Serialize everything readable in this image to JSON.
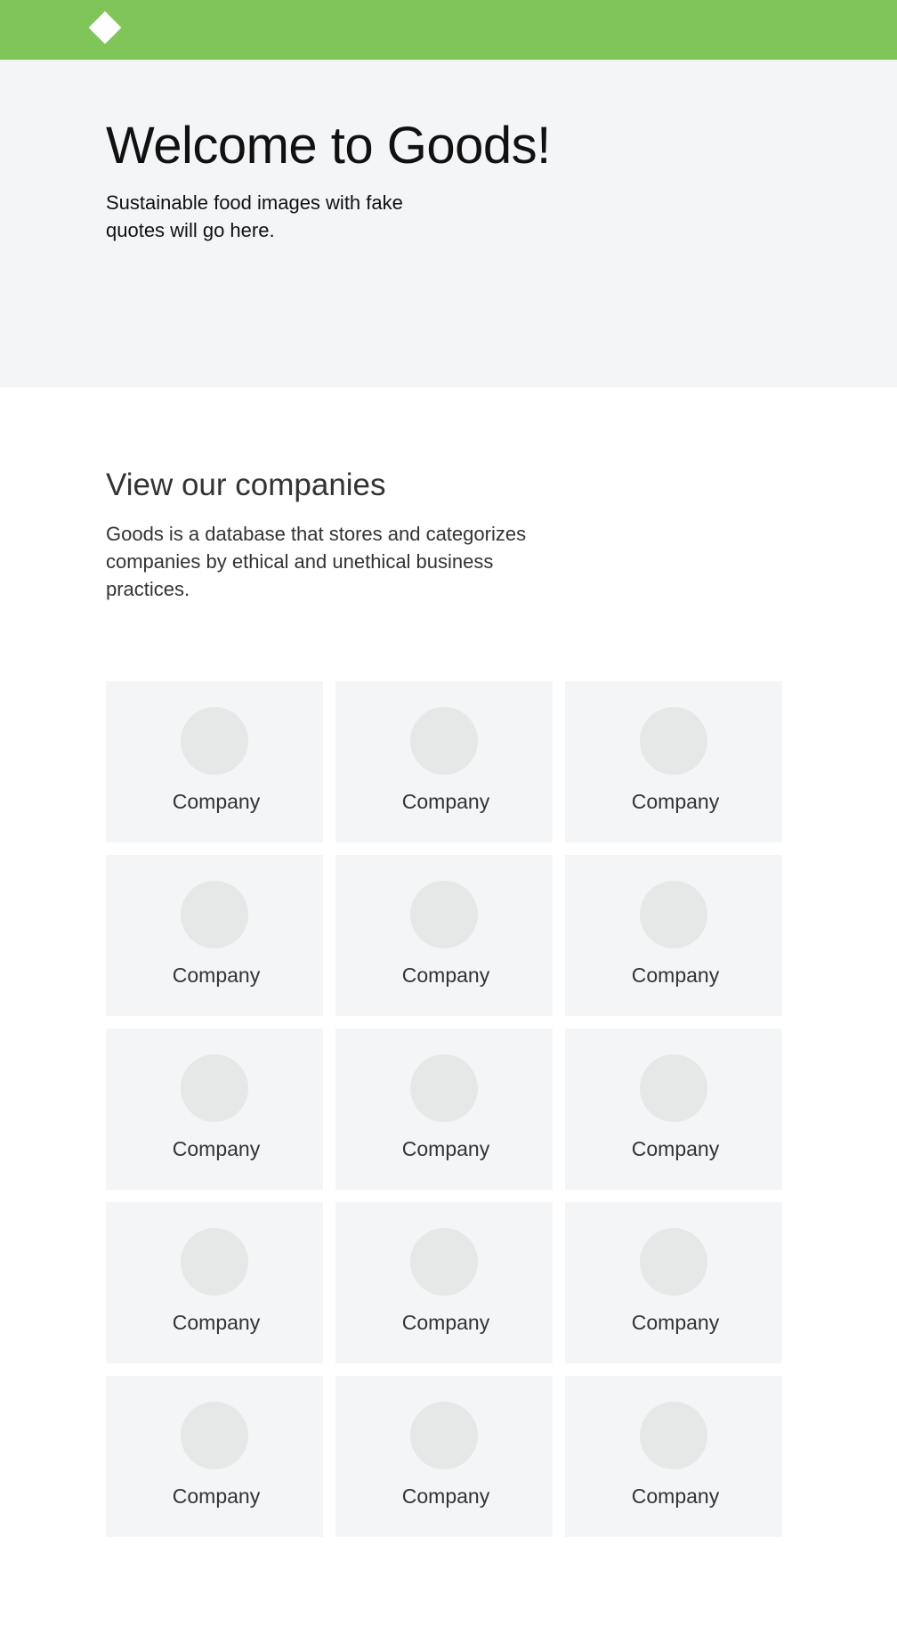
{
  "header": {
    "logo_icon": "diamond-logo-icon",
    "brand_color": "#80c55a"
  },
  "hero": {
    "title": "Welcome to Goods!",
    "subtitle": "Sustainable food images with fake quotes will go here."
  },
  "companies_section": {
    "title": "View our companies",
    "description": "Goods is a database that stores and categorizes companies by ethical and unethical business practices."
  },
  "companies": [
    {
      "name": "Company"
    },
    {
      "name": "Company"
    },
    {
      "name": "Company"
    },
    {
      "name": "Company"
    },
    {
      "name": "Company"
    },
    {
      "name": "Company"
    },
    {
      "name": "Company"
    },
    {
      "name": "Company"
    },
    {
      "name": "Company"
    },
    {
      "name": "Company"
    },
    {
      "name": "Company"
    },
    {
      "name": "Company"
    },
    {
      "name": "Company"
    },
    {
      "name": "Company"
    },
    {
      "name": "Company"
    }
  ]
}
